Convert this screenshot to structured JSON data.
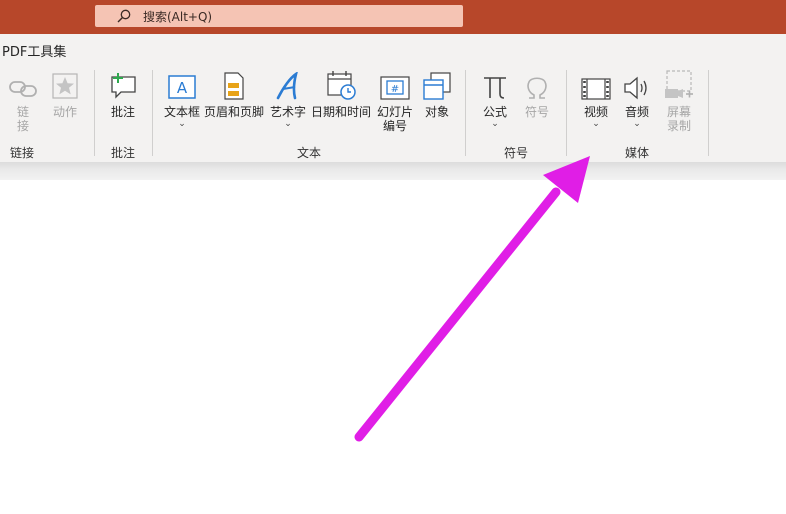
{
  "search": {
    "placeholder": "搜索(Alt+Q)",
    "icon": "search-icon"
  },
  "ribbon_tab": "PDF工具集",
  "buttons": {
    "link": {
      "label_top": "链",
      "label_bottom": "接",
      "icon": "link-icon",
      "enabled": false
    },
    "action": {
      "label": "动作",
      "icon": "star-icon",
      "enabled": false
    },
    "comment": {
      "label": "批注",
      "icon": "comment-icon"
    },
    "textbox": {
      "label": "文本框",
      "icon": "textbox-icon",
      "dropdown": "⌄"
    },
    "header_footer": {
      "label": "页眉和页脚",
      "icon": "header-footer-icon"
    },
    "wordart": {
      "label": "艺术字",
      "icon": "wordart-icon",
      "dropdown": "⌄"
    },
    "datetime": {
      "label": "日期和时间",
      "icon": "calendar-clock-icon"
    },
    "slide_number": {
      "label_top": "幻灯片",
      "label_bottom": "编号",
      "icon": "slide-number-icon"
    },
    "object": {
      "label": "对象",
      "icon": "object-icon"
    },
    "equation": {
      "label": "公式",
      "icon": "pi-icon",
      "dropdown": "⌄"
    },
    "symbol": {
      "label": "符号",
      "icon": "omega-icon",
      "enabled": false
    },
    "video": {
      "label": "视频",
      "icon": "film-icon",
      "dropdown": "⌄"
    },
    "audio": {
      "label": "音频",
      "icon": "speaker-icon",
      "dropdown": "⌄"
    },
    "screen_recording": {
      "label_top": "屏幕",
      "label_bottom": "录制",
      "icon": "screen-record-icon",
      "enabled": false
    }
  },
  "groups": {
    "links": "链接",
    "comments": "批注",
    "text": "文本",
    "symbols": "符号",
    "media": "媒体"
  },
  "colors": {
    "titlebar": "#b7472a",
    "search_box": "#f5c4b4",
    "ribbon": "#f3f2f1",
    "accent_blue": "#2b7cd3",
    "annotation_arrow": "#e01ee6"
  }
}
